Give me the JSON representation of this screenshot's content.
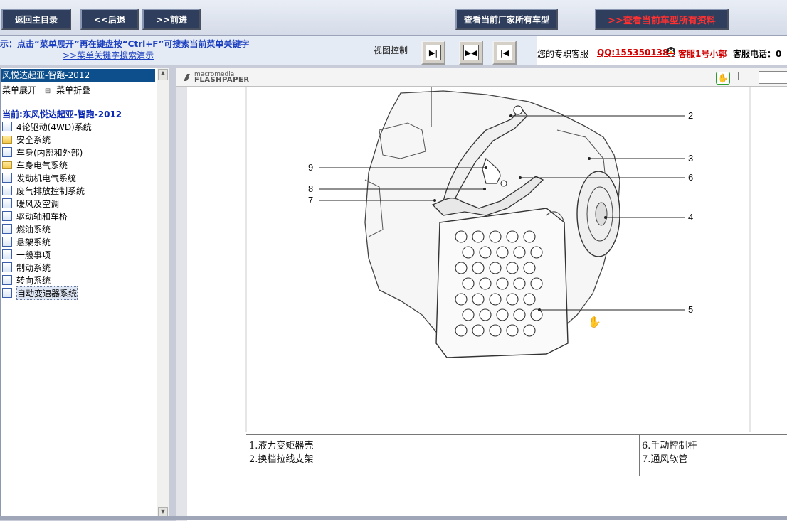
{
  "topbar": {
    "home_button": "返回主目录",
    "back_button": "<<后退",
    "forward_button": ">>前进",
    "maker_models_button": "查看当前厂家所有车型",
    "model_docs_button": ">>查看当前车型所有资料"
  },
  "tipbar": {
    "tip_text": "示：点击“菜单展开”再在键盘按“Ctrl+F”可搜索当前菜单关键字",
    "tip_link": ">>菜单关键字搜索演示",
    "view_control_label": "视图控制"
  },
  "service": {
    "exclusive_label": "您的专职客服",
    "qq": "QQ:1553501388",
    "agent": "客服1号小郭",
    "phone_label": "客服电话：0"
  },
  "sidebar": {
    "selected_title": "风悦达起亚-智跑-2012",
    "expand_label": "菜单展开",
    "collapse_label": "菜单折叠",
    "current_label": "当前:东风悦达起亚-智跑-2012",
    "items": [
      {
        "label": "4轮驱动(4WD)系统",
        "icon": "page"
      },
      {
        "label": "安全系统",
        "icon": "folder"
      },
      {
        "label": "车身(内部和外部)",
        "icon": "page"
      },
      {
        "label": "车身电气系统",
        "icon": "folder"
      },
      {
        "label": "发动机电气系统",
        "icon": "page"
      },
      {
        "label": "废气排放控制系统",
        "icon": "page"
      },
      {
        "label": "暖风及空调",
        "icon": "page"
      },
      {
        "label": "驱动轴和车桥",
        "icon": "page"
      },
      {
        "label": "燃油系统",
        "icon": "page"
      },
      {
        "label": "悬架系统",
        "icon": "page"
      },
      {
        "label": "一般事项",
        "icon": "page"
      },
      {
        "label": "制动系统",
        "icon": "page"
      },
      {
        "label": "转向系统",
        "icon": "page"
      },
      {
        "label": "自动变速器系统",
        "icon": "page"
      }
    ]
  },
  "viewer": {
    "logo_brand": "macromedia",
    "logo_product": "FLASHPAPER",
    "callouts": [
      "2",
      "3",
      "4",
      "5",
      "6",
      "7",
      "8",
      "9"
    ],
    "legend_left": [
      "1.液力变矩器壳",
      "2.换档拉线支架"
    ],
    "legend_right": [
      "6.手动控制杆",
      "7.通风软管"
    ]
  }
}
